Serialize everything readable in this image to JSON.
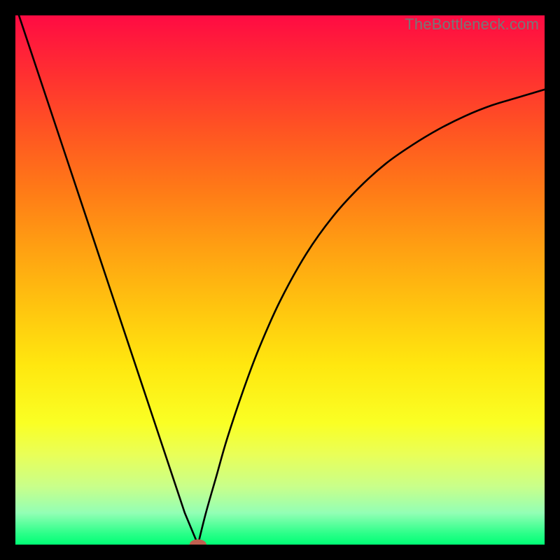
{
  "watermark": {
    "text": "TheBottleneck.com"
  },
  "chart_data": {
    "type": "line",
    "title": "",
    "xlabel": "",
    "ylabel": "",
    "xlim": [
      0,
      100
    ],
    "ylim": [
      0,
      100
    ],
    "series": [
      {
        "name": "left-branch",
        "x": [
          0,
          3,
          6,
          9,
          12,
          15,
          18,
          21,
          24,
          27,
          30,
          32,
          34.5
        ],
        "y": [
          102,
          93,
          84,
          75,
          66,
          57,
          48,
          39,
          30,
          21,
          12,
          6,
          0
        ]
      },
      {
        "name": "right-branch",
        "x": [
          34.5,
          36,
          38,
          40,
          43,
          46,
          50,
          55,
          60,
          65,
          70,
          75,
          80,
          85,
          90,
          95,
          100
        ],
        "y": [
          0,
          6,
          13,
          20,
          29,
          37,
          46,
          55,
          62,
          67.5,
          72,
          75.5,
          78.5,
          81,
          83,
          84.5,
          86
        ]
      }
    ],
    "marker": {
      "x": 34.5,
      "y": 0,
      "rx": 1.6,
      "ry": 1.0,
      "color": "#c06050"
    },
    "background_gradient": {
      "top": "#ff0b43",
      "bottom": "#00ff75"
    }
  }
}
